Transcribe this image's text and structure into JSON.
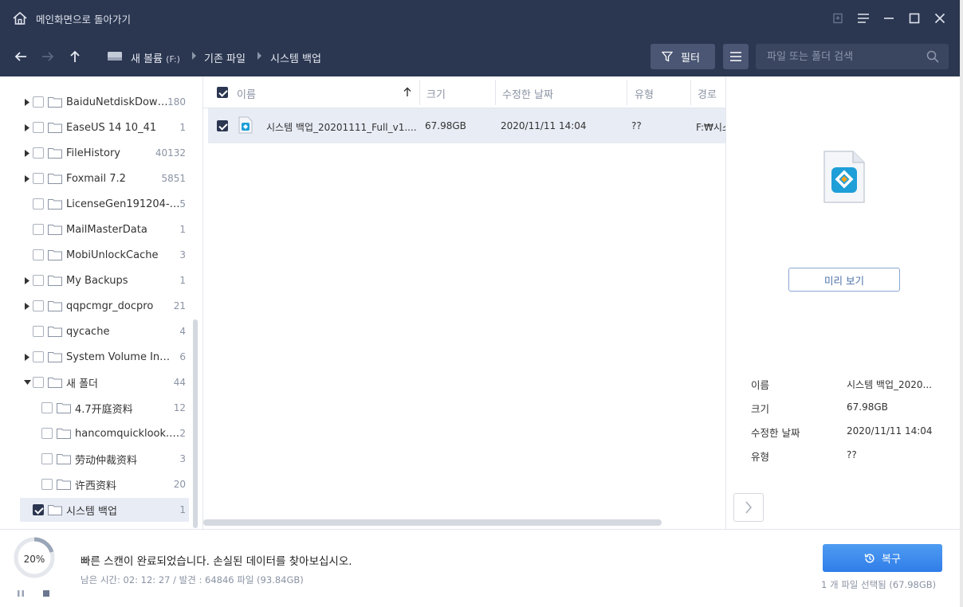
{
  "titlebar": {
    "back_home": "메인화면으로 돌아가기"
  },
  "navbar": {
    "drive": "새 볼륨",
    "drive_letter": "(F:)",
    "crumb_2": "기존 파일",
    "crumb_3": "시스템 백업",
    "filter_label": "필터",
    "search_placeholder": "파일 또는 폴더 검색"
  },
  "tree": {
    "items": [
      {
        "name": "BaiduNetdiskDownl...",
        "count": "180"
      },
      {
        "name": "EaseUS 14 10_41",
        "count": "1"
      },
      {
        "name": "FileHistory",
        "count": "40132"
      },
      {
        "name": "Foxmail 7.2",
        "count": "5851"
      },
      {
        "name": "LicenseGen191204-New",
        "count": "5"
      },
      {
        "name": "MailMasterData",
        "count": "1"
      },
      {
        "name": "MobiUnlockCache",
        "count": "3"
      },
      {
        "name": "My Backups",
        "count": "1"
      },
      {
        "name": "qqpcmgr_docpro",
        "count": "21"
      },
      {
        "name": "qycache",
        "count": "4"
      },
      {
        "name": "System Volume Infor...",
        "count": "6"
      },
      {
        "name": "새 폴더",
        "count": "44"
      },
      {
        "name": "4.7开庭资料",
        "count": "12"
      },
      {
        "name": "hancomquicklook.pkg",
        "count": "2"
      },
      {
        "name": "劳动仲裁资料",
        "count": "3"
      },
      {
        "name": "许西资料",
        "count": "20"
      },
      {
        "name": "시스템 백업",
        "count": "1"
      }
    ]
  },
  "list": {
    "headers": {
      "name": "이름",
      "size": "크기",
      "modified": "수정한 날짜",
      "type": "유형",
      "path": "경로"
    },
    "rows": [
      {
        "name": "시스템 백업_20201111_Full_v1....",
        "size": "67.98GB",
        "modified": "2020/11/11 14:04",
        "type": "??",
        "path": "F:₩시스"
      }
    ]
  },
  "preview": {
    "preview_button": "미리 보기",
    "labels": {
      "name": "이름",
      "size": "크기",
      "modified": "수정한 날짜",
      "type": "유형"
    },
    "values": {
      "name": "시스템 백업_2020...",
      "size": "67.98GB",
      "modified": "2020/11/11 14:04",
      "type": "??"
    }
  },
  "status": {
    "progress_label": "20%",
    "progress": 0.2,
    "message": "빠른 스캔이 완료되었습니다. 손실된  데이터를 찾아보십시오.",
    "detail": "남은 시간: 02: 12: 27 / 발견 : 64846 파일 (93.84GB)",
    "recover_label": "복구",
    "selection": "1 개 파일 선택됨 (67.98GB)"
  },
  "colors": {
    "header_bg": "#2b3650",
    "accent_blue": "#2f7de8",
    "selected_row": "#e8ecf5"
  }
}
